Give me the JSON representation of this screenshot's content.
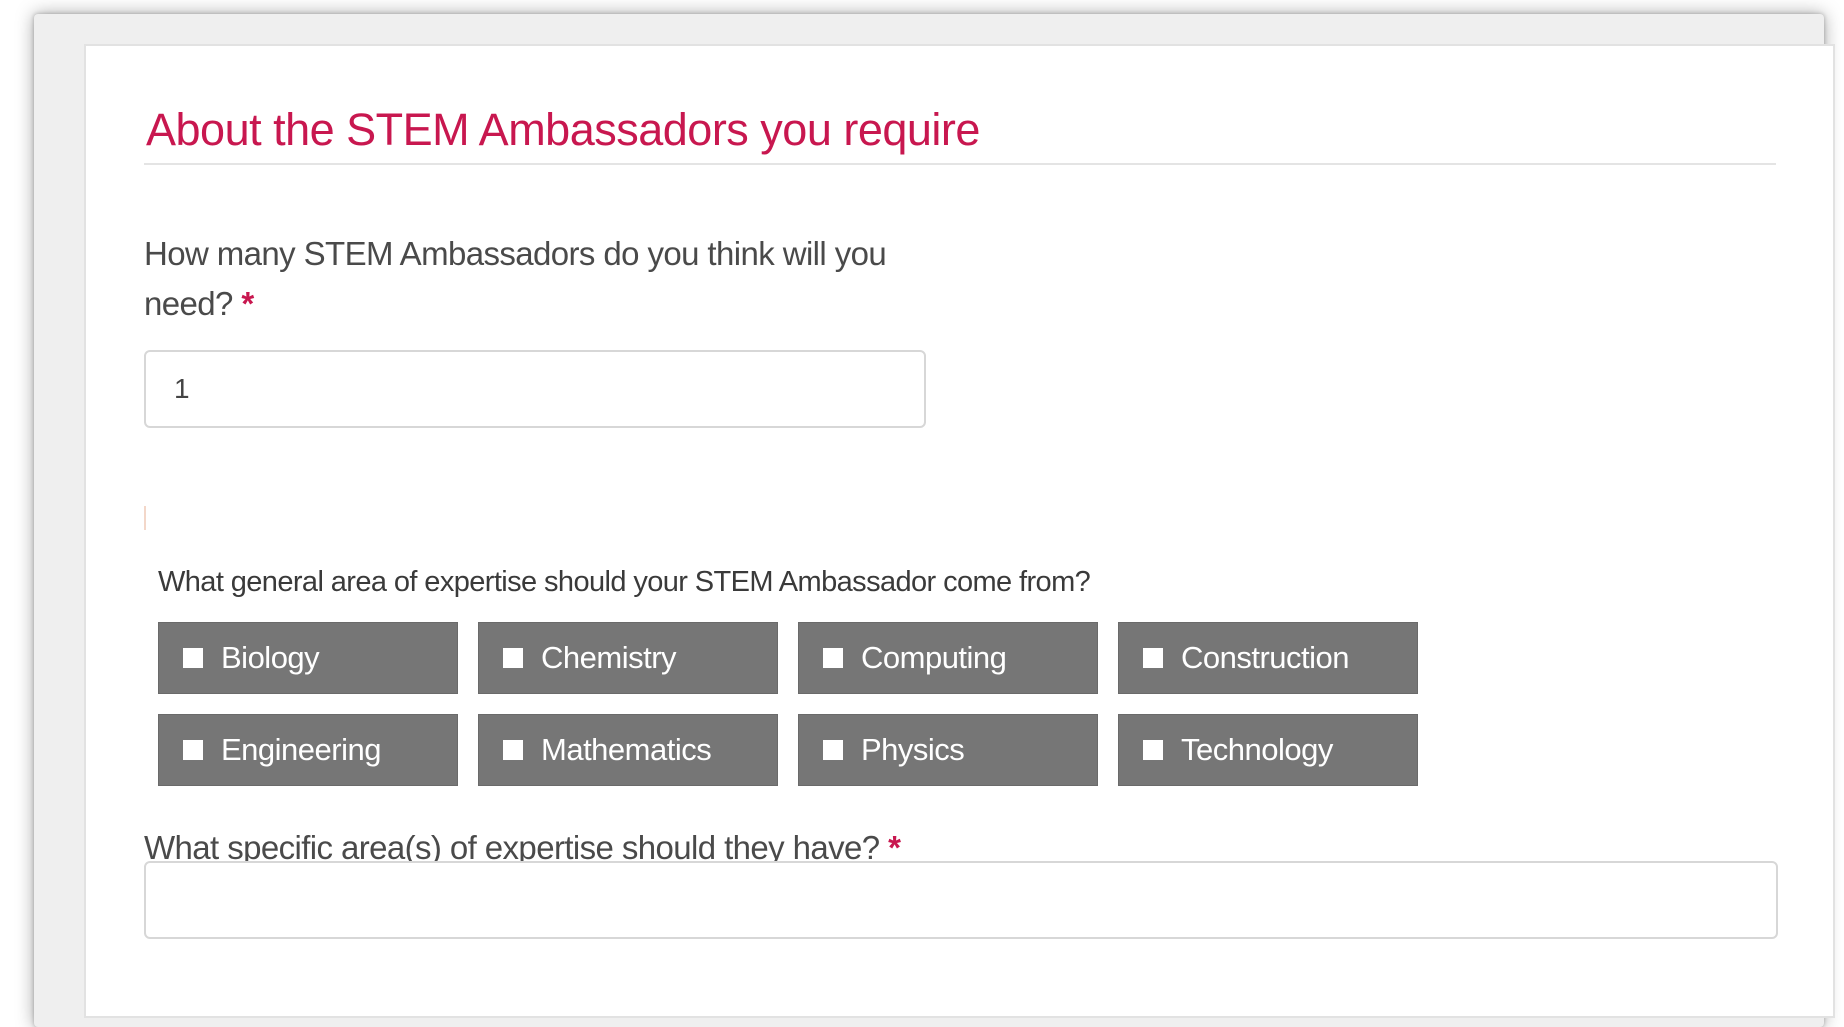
{
  "section": {
    "title": "About the STEM Ambassadors you require"
  },
  "questions": {
    "count": {
      "label": "How many STEM Ambassadors do you think will you need?",
      "required_marker": "*",
      "value": "1"
    },
    "general_area": {
      "label": "What general area of expertise should your STEM Ambassador come from?",
      "options": [
        {
          "label": "Biology",
          "checked": false
        },
        {
          "label": "Chemistry",
          "checked": false
        },
        {
          "label": "Computing",
          "checked": false
        },
        {
          "label": "Construction",
          "checked": false
        },
        {
          "label": "Engineering",
          "checked": false
        },
        {
          "label": "Mathematics",
          "checked": false
        },
        {
          "label": "Physics",
          "checked": false
        },
        {
          "label": "Technology",
          "checked": false
        }
      ]
    },
    "specific_area": {
      "label": "What specific area(s) of expertise should they have?",
      "required_marker": "*",
      "value": ""
    }
  },
  "colors": {
    "accent": "#c8174f",
    "tile_background": "#767676",
    "label_text": "#4a4a4a"
  },
  "icons": {
    "checkbox": "checkbox-unchecked-icon"
  }
}
